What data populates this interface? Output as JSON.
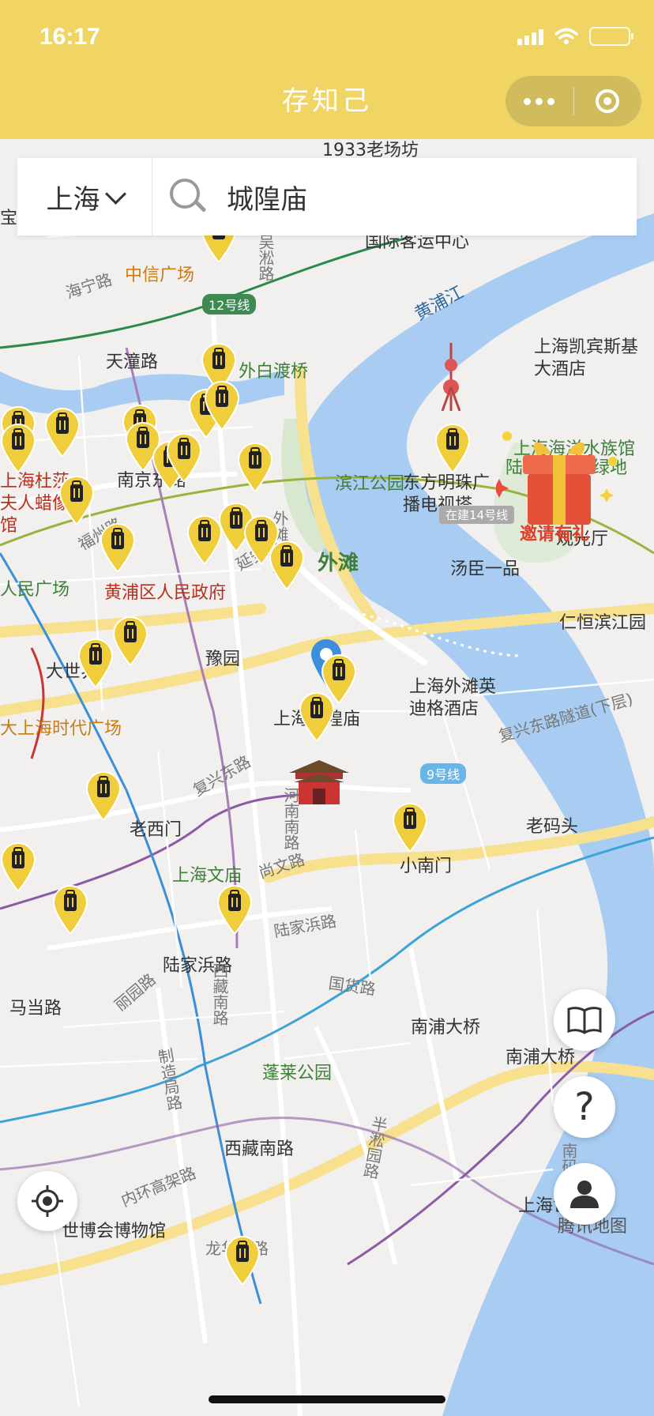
{
  "status": {
    "time": "16:17"
  },
  "app": {
    "title": "存知己"
  },
  "search": {
    "city": "上海",
    "query": "城隍庙"
  },
  "gift": {
    "label": "邀请有礼"
  },
  "map": {
    "labels": {
      "lbl_1933": "1933老场坊",
      "lbl_baoshan": "宝山路",
      "lbl_guoji": "国际客运中心",
      "lbl_haining": "海宁路",
      "lbl_zhongxin": "中信广场",
      "lbl_wusong": "吴淞路",
      "lbl_line12": "12号线",
      "lbl_huangpujiang": "黄浦江",
      "lbl_tiantong": "天潼路",
      "lbl_waibaidu": "外白渡桥",
      "lbl_kerry": "上海凯宾斯基大酒店",
      "lbl_aquarium": "上海海洋水族馆",
      "lbl_pearl": "东方明珠广播电视塔",
      "lbl_binjiang": "滨江公园",
      "lbl_lujiazui_green": "陆家嘴中心绿地",
      "lbl_nanjing": "南京东路",
      "lbl_waitan_tunnel": "外滩隧道",
      "lbl_wax": "上海杜莎夫人蜡像馆",
      "lbl_line14": "在建14号线",
      "lbl_guanguang": "观光厅",
      "lbl_fuzhou": "福州路",
      "lbl_bund": "外滩",
      "lbl_tangchen": "汤臣一品",
      "lbl_yanan": "延安路",
      "lbl_gov": "黄浦区人民政府",
      "lbl_renmin": "人民广场",
      "lbl_renheng": "仁恒滨江园",
      "lbl_yuyuan": "豫园",
      "lbl_dashijie": "大世界",
      "lbl_indigo": "上海外滩英迪格酒店",
      "lbl_chenghuang": "上海城隍庙",
      "lbl_fuxing_tunnel": "复兴东路隧道(下层)",
      "lbl_times": "大上海时代广场",
      "lbl_line9": "9号线",
      "lbl_fuxing": "复兴东路",
      "lbl_henan": "河南南路",
      "lbl_laoximen": "老西门",
      "lbl_laomatou": "老码头",
      "lbl_xiaonanmen": "小南门",
      "lbl_wenmiao": "上海文庙",
      "lbl_shangwen": "尚文路",
      "lbl_lujiabang": "陆家浜路",
      "lbl_lujiabang_st": "陆家浜路",
      "lbl_madang": "马当路",
      "lbl_liyuan": "丽园路",
      "lbl_xizang": "西藏南路",
      "lbl_guohuo": "国货路",
      "lbl_nanpu": "南浦大桥",
      "lbl_nanpu2": "南浦大桥",
      "lbl_penglai": "蓬莱公园",
      "lbl_zhizao": "制造局路",
      "lbl_banxiu": "半淞园路",
      "lbl_xizang_st": "西藏南路",
      "lbl_neihuan": "内环高架路",
      "lbl_expo_museum": "世博会博物馆",
      "lbl_expo": "上海世博",
      "lbl_longhua": "龙华东路",
      "lbl_tencent": "腾讯地图",
      "lbl_nanmatou": "南码头路"
    }
  },
  "icons": [
    "location-target-icon",
    "book-icon",
    "help-icon",
    "user-icon",
    "search-icon",
    "gift-icon"
  ]
}
